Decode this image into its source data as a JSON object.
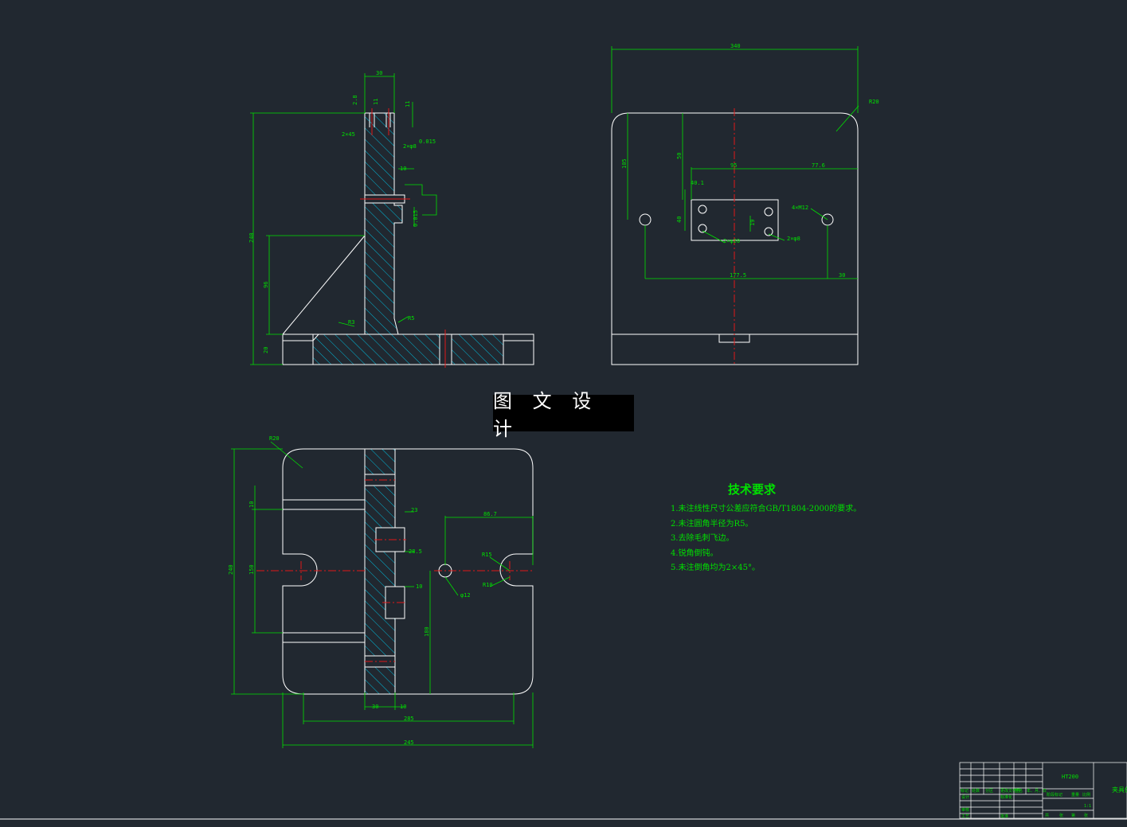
{
  "watermark": "图 文 设 计",
  "tech_requirements": {
    "title": "技术要求",
    "items": [
      "1.未注线性尺寸公差应符合GB/T1804-2000的要求。",
      "2.未注圆角半径为R5。",
      "3.去除毛刺飞边。",
      "4.锐角倒钝。",
      "5.未注倒角均为2×45°。"
    ]
  },
  "side_view": {
    "dims": [
      "30",
      "2.8",
      "11",
      "11",
      "2×45",
      "2×φ8",
      "0.015",
      "10",
      "240",
      "96",
      "R3",
      "R5",
      "20",
      "0.015"
    ]
  },
  "front_view": {
    "dims": [
      "340",
      "R20",
      "105",
      "50",
      "95",
      "77.6",
      "40.1",
      "40",
      "19",
      "4×M12",
      "2×φ20",
      "2×φ8",
      "177.5",
      "30"
    ]
  },
  "top_view": {
    "dims": [
      "R20",
      "10",
      "150",
      "240",
      "23",
      "86.7",
      "R15",
      "28.5",
      "10",
      "R10",
      "φ12",
      "180",
      "10",
      "30",
      "285",
      "245"
    ]
  },
  "title_block": {
    "material": "HT200",
    "drawing_name": "夹具体",
    "scale": "1:1",
    "labels": [
      "标记",
      "处数",
      "分区",
      "更改文件号",
      "签名",
      "年、月、日",
      "设计",
      "标准化",
      "审核",
      "工艺",
      "批准",
      "阶段标记",
      "重量",
      "比例",
      "共",
      "张",
      "第",
      "张"
    ]
  },
  "colors": {
    "background": "#212830",
    "outline": "#ffffff",
    "dimension": "#00e000",
    "hatch": "#00b8d8",
    "centerline": "#e01818"
  }
}
